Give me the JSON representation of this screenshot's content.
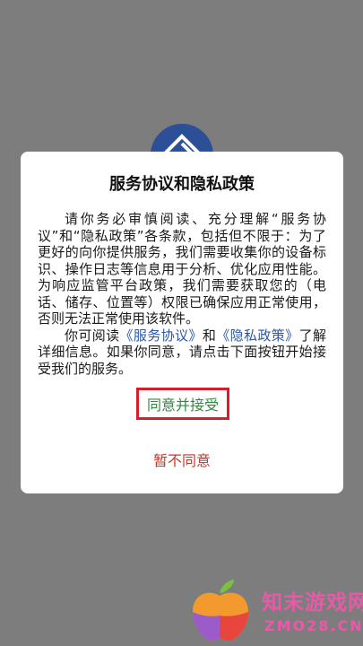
{
  "dialog": {
    "title": "服务协议和隐私政策",
    "paragraph1": "请你务必审慎阅读、充分理解“服务协议”和“隐私政策”各条款，包括但不限于：为了更好的向你提供服务，我们需要收集你的设备标识、操作日志等信息用于分析、优化应用性能。为响应监管平台政策，我们需要获取您的（电话、储存、位置等）权限已确保应用正常使用，否则无法正常使用该软件。",
    "paragraph2_prefix": "你可阅读",
    "service_link": "《服务协议》",
    "paragraph2_and": "和",
    "privacy_link": "《隐私政策》",
    "paragraph2_suffix": "了解详细信息。如果你同意，请点击下面按钮开始接受我们的服务。",
    "agree_label": "同意并接受",
    "disagree_label": "暂不同意"
  },
  "watermark": {
    "name_cn": "知末游戏网",
    "domain": "ZMO28.CN"
  },
  "colors": {
    "overlay": "#7d7d7d",
    "link": "#2a58a6",
    "agree_text": "#2e8b3c",
    "agree_border": "#d61d2b",
    "disagree_text": "#c0392b",
    "watermark": "#e85aa8"
  },
  "icons": {
    "app_logo": "app-logo-icon",
    "watermark_logo": "apple-logo-icon"
  }
}
